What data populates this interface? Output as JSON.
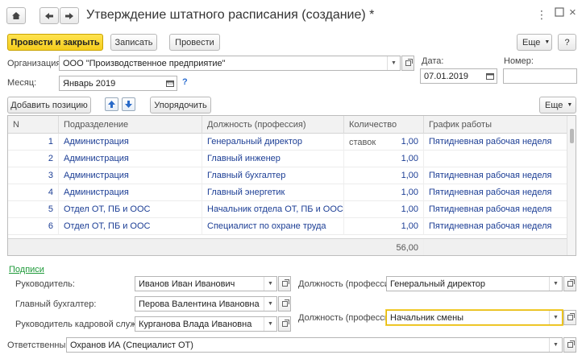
{
  "window": {
    "title": "Утверждение штатного расписания (создание) *"
  },
  "toolbar": {
    "post_close": "Провести и закрыть",
    "save": "Записать",
    "post": "Провести",
    "more": "Еще"
  },
  "header": {
    "org_label": "Организация:",
    "org_value": "ООО \"Производственное предприятие\"",
    "date_label": "Дата:",
    "date_value": "07.01.2019",
    "number_label": "Номер:",
    "number_value": "",
    "month_label": "Месяц:",
    "month_value": "Январь 2019",
    "help": "?"
  },
  "table_toolbar": {
    "add": "Добавить позицию",
    "sort": "Упорядочить",
    "more": "Еще"
  },
  "table": {
    "columns": [
      "N",
      "Подразделение",
      "Должность (профессия)",
      "Количество ставок",
      "График работы"
    ],
    "rows": [
      [
        "1",
        "Администрация",
        "Генеральный директор",
        "1,00",
        "Пятидневная рабочая неделя"
      ],
      [
        "2",
        "Администрация",
        "Главный инженер",
        "1,00",
        ""
      ],
      [
        "3",
        "Администрация",
        "Главный бухгалтер",
        "1,00",
        "Пятидневная рабочая неделя"
      ],
      [
        "4",
        "Администрация",
        "Главный энергетик",
        "1,00",
        "Пятидневная рабочая неделя"
      ],
      [
        "5",
        "Отдел ОТ, ПБ и ООС",
        "Начальник отдела ОТ, ПБ и ООС",
        "1,00",
        "Пятидневная рабочая неделя"
      ],
      [
        "6",
        "Отдел ОТ, ПБ и ООС",
        "Специалист по охране труда",
        "1,00",
        "Пятидневная рабочая неделя"
      ]
    ],
    "total": "56,00"
  },
  "signatures": {
    "section": "Подписи",
    "head_label": "Руководитель:",
    "head_value": "Иванов Иван Иванович",
    "head_pos_label": "Должность (профессия):",
    "head_pos_value": "Генеральный директор",
    "accountant_label": "Главный бухгалтер:",
    "accountant_value": "Перова Валентина Ивановна",
    "hr_label": "Руководитель кадровой службы:",
    "hr_value": "Курганова Влада Ивановна",
    "hr_pos_label": "Должность (профессия):",
    "hr_pos_value": "Начальник смены",
    "resp_label": "Ответственный:",
    "resp_value": "Охранов ИА (Специалист ОТ)"
  },
  "colors": {
    "primary": "#f5cd1d",
    "link": "#1c3e95",
    "section": "#1f9a3a"
  }
}
